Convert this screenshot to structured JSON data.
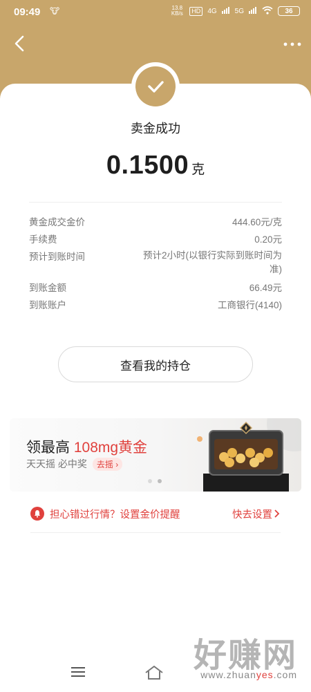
{
  "status_bar": {
    "time": "09:49",
    "net_speed": "13.8 KB/s",
    "hd_badge": "HD",
    "signal1": "4G",
    "signal2": "5G",
    "battery": "36"
  },
  "header": {
    "back_icon": "chevron-left-icon",
    "more_icon": "more-dots-icon"
  },
  "result": {
    "title": "卖金成功",
    "amount": "0.1500",
    "unit": "克"
  },
  "details": [
    {
      "label": "黄金成交金价",
      "value": "444.60元/克"
    },
    {
      "label": "手续费",
      "value": "0.20元"
    },
    {
      "label": "预计到账时间",
      "value": "预计2小时(以银行实际到账时间为准)"
    },
    {
      "label": "到账金额",
      "value": "66.49元"
    },
    {
      "label": "到账账户",
      "value": "工商银行(4140)"
    }
  ],
  "position_button": "查看我的持仓",
  "banner": {
    "title_prefix": "领最高 ",
    "title_highlight": "108mg黄金",
    "subtitle": "天天摇 必中奖",
    "cta": "去摇",
    "page_index": 2,
    "page_count": 2
  },
  "reminder": {
    "text": "担心错过行情？设置金价提醒",
    "link": "快去设置"
  },
  "watermark": {
    "big": "好赚网",
    "url_prefix": "www.zhuan",
    "url_highlight": "yes",
    "url_suffix": ".com"
  },
  "colors": {
    "brand_gold": "#c8a66b",
    "accent_red": "#e0413d"
  }
}
